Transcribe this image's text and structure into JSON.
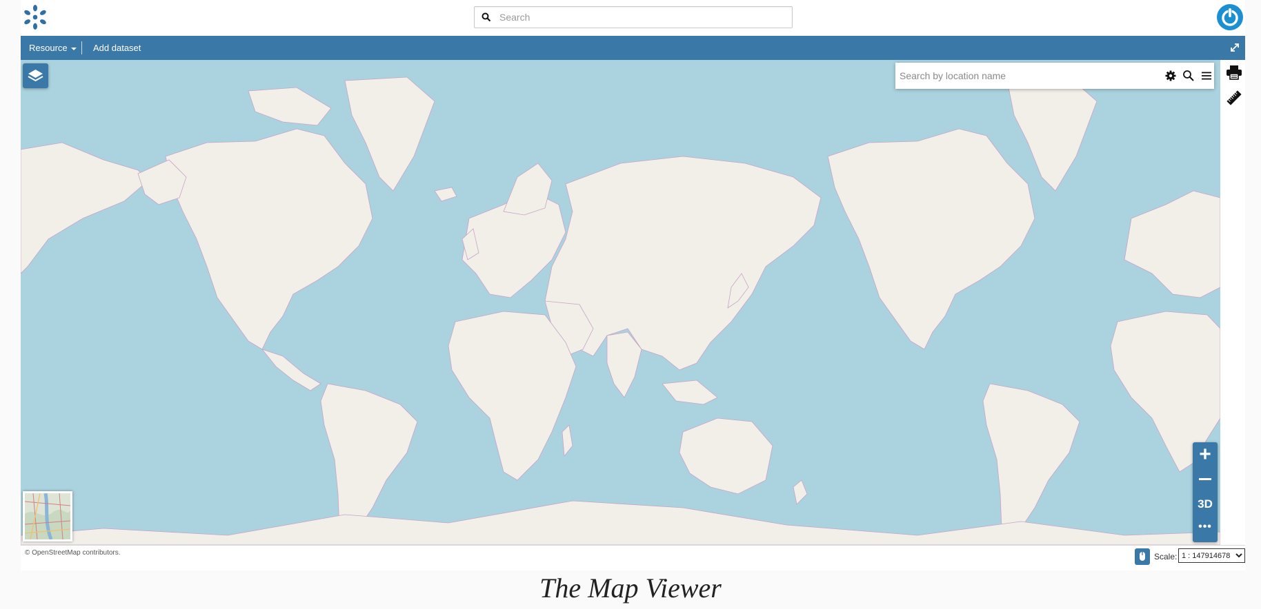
{
  "header": {
    "logo_icon": "kanban-dots-logo",
    "search_placeholder": "Search",
    "search_value": "",
    "power_icon": "power-icon"
  },
  "toolbar": {
    "resource_label": "Resource",
    "add_dataset_label": "Add dataset",
    "expand_icon": "expand-icon"
  },
  "map": {
    "location_search_placeholder": "Search by location name",
    "location_search_value": "",
    "zoom_in_label": "+",
    "three_d_label": "3D",
    "more_label": "•••",
    "right_tools": [
      "print-icon",
      "measure-icon"
    ],
    "location_tools": [
      "gear-icon",
      "search-icon",
      "menu-icon"
    ]
  },
  "bottom_bar": {
    "attribution": "© OpenStreetMap contributors.",
    "scale_label": "Scale:",
    "scale_value": "1 : 147914678"
  },
  "caption": "The Map Viewer",
  "colors": {
    "accent": "#3a78a8",
    "ocean": "#aad3df",
    "land": "#f2efe9",
    "border": "#c8a3c8"
  }
}
